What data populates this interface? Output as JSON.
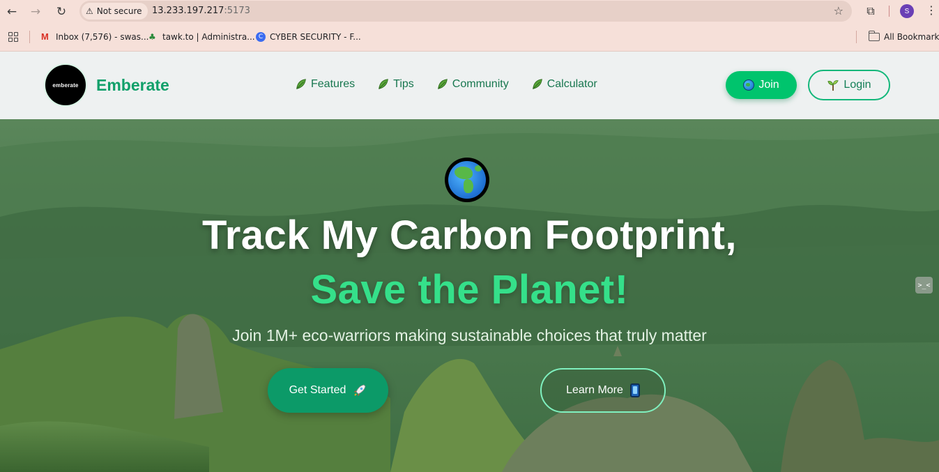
{
  "browser": {
    "security_label": "Not secure",
    "url_host": "13.233.197.217",
    "url_port": ":5173",
    "profile_initial": "S",
    "bookmarks": [
      {
        "label": "Inbox (7,576) - swas..."
      },
      {
        "label": "tawk.to | Administra..."
      },
      {
        "label": "CYBER SECURITY - F..."
      }
    ],
    "all_bookmarks_label": "All Bookmarks"
  },
  "header": {
    "logo_text": "emberate",
    "brand": "Emberate",
    "nav": [
      {
        "label": "Features"
      },
      {
        "label": "Tips"
      },
      {
        "label": "Community"
      },
      {
        "label": "Calculator"
      }
    ],
    "join_label": "Join",
    "login_label": "Login"
  },
  "hero": {
    "title_line1": "Track My Carbon Footprint,",
    "title_line2": "Save the Planet!",
    "subtitle": "Join 1M+ eco-warriors making sustainable choices that truly matter",
    "primary_cta": "Get Started",
    "secondary_cta": "Learn More",
    "widget_text": ">_<"
  },
  "colors": {
    "brand_green": "#11a06a",
    "accent_green": "#35e08a",
    "join_bg": "#00c46d",
    "browser_bg": "#f6e0d9"
  }
}
